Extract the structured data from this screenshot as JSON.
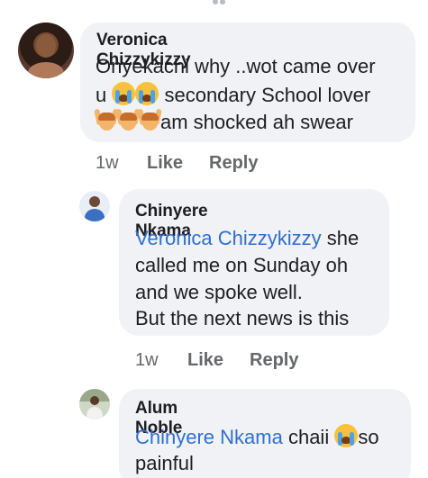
{
  "comments": [
    {
      "author": "Veronica Chizzykizzy",
      "lines": [
        {
          "text": "Onyekachi why ..wot came over"
        },
        {
          "text_before": "u ",
          "emojis": [
            "crying-face",
            "crying-face"
          ],
          "text_after": " secondary School lover"
        },
        {
          "emojis": [
            "raising-hands",
            "raising-hands",
            "raising-hands"
          ],
          "text_after": "am shocked ah swear"
        }
      ],
      "time": "1w",
      "like": "Like",
      "reply": "Reply"
    },
    {
      "author": "Chinyere Nkama",
      "mention": "Veronica Chizzykizzy",
      "lines": [
        {
          "text_after_mention": " she"
        },
        {
          "text": "called me on Sunday oh"
        },
        {
          "text": "and we spoke well."
        },
        {
          "text": "But the next news is this"
        }
      ],
      "time": "1w",
      "like": "Like",
      "reply": "Reply"
    },
    {
      "author": "Alum Noble",
      "mention": "Chinyere Nkama",
      "lines": [
        {
          "text_after_mention": " chaii ",
          "emojis": [
            "crying-face"
          ],
          "text_end": "so"
        },
        {
          "text": "painful"
        }
      ]
    }
  ],
  "colors": {
    "bubble": "#f0f2f5",
    "text": "#1c1e21",
    "meta": "#65676b",
    "mention": "#2f6fd0"
  }
}
